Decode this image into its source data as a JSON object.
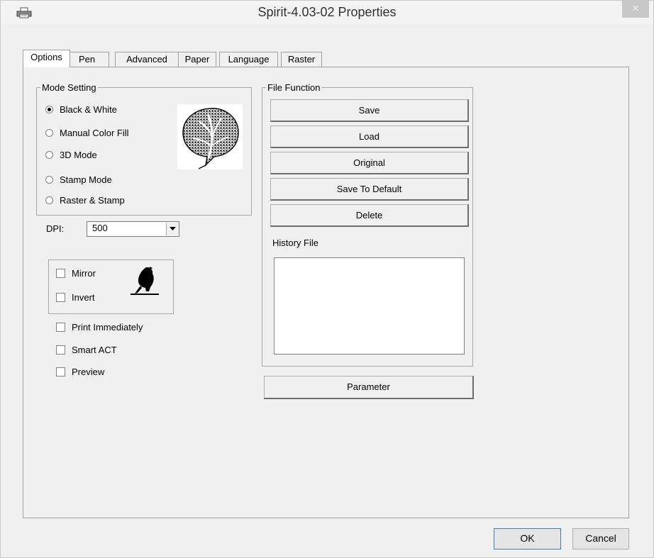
{
  "window": {
    "title": "Spirit-4.03-02 Properties",
    "close_label": "×"
  },
  "tabs": [
    {
      "label": "Options",
      "active": true
    },
    {
      "label": "Pen"
    },
    {
      "label": "Advanced"
    },
    {
      "label": "Paper"
    },
    {
      "label": "Language"
    },
    {
      "label": "Raster"
    }
  ],
  "mode_setting": {
    "legend": "Mode Setting",
    "options": [
      {
        "label": "Black & White",
        "selected": true
      },
      {
        "label": "Manual Color Fill"
      },
      {
        "label": "3D Mode"
      },
      {
        "label": "Stamp Mode"
      },
      {
        "label": "Raster & Stamp"
      }
    ],
    "preview_image": "leaf-halftone-image"
  },
  "dpi": {
    "label": "DPI:",
    "value": "500"
  },
  "image_options": {
    "mirror_label": "Mirror",
    "invert_label": "Invert",
    "preview_image": "bird-silhouette-image"
  },
  "print_immediately_label": "Print Immediately",
  "smart_act_label": "Smart ACT",
  "preview_label": "Preview",
  "file_function": {
    "legend": "File Function",
    "save_label": "Save",
    "load_label": "Load",
    "original_label": "Original",
    "save_to_default_label": "Save To Default",
    "delete_label": "Delete",
    "history_label": "History File"
  },
  "parameter_label": "Parameter",
  "footer": {
    "ok_label": "OK",
    "cancel_label": "Cancel"
  },
  "colors": {
    "window_bg": "#f0f0f0",
    "default_button_border": "#3c7fb1",
    "close_button_bg": "#c7c7c7"
  }
}
